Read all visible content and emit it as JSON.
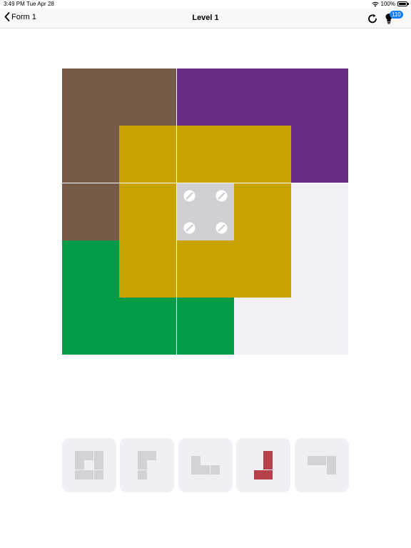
{
  "status_bar": {
    "time": "3:49 PM",
    "date": "Tue Apr 28",
    "battery": "100%"
  },
  "nav": {
    "back_label": "Form 1",
    "title": "Level 1",
    "hint_count": "110",
    "icons": [
      "chevron-left-icon",
      "restart-icon",
      "lightbulb-icon"
    ]
  },
  "colors": {
    "brown": "#735b48",
    "purple": "#6a2b87",
    "gold": "#c8a200",
    "green": "#009c48",
    "empty": "#f1f0f5",
    "blocked": "#d0cfd4",
    "tray_inactive": "#d3d2d7",
    "tray_active": "#b7414b",
    "badge": "#1a7cf5"
  },
  "board": {
    "rows": 5,
    "cols": 5,
    "grid": [
      [
        "brown",
        "brown",
        "purple",
        "purple",
        "purple"
      ],
      [
        "brown",
        "gold",
        "gold",
        "gold",
        "purple"
      ],
      [
        "brown",
        "gold",
        "blocked",
        "gold",
        "empty"
      ],
      [
        "green",
        "gold",
        "gold",
        "gold",
        "empty"
      ],
      [
        "green",
        "green",
        "green",
        "empty",
        "empty"
      ]
    ]
  },
  "tray": {
    "pieces": [
      {
        "name": "ring-piece",
        "placed": true,
        "shape": [
          [
            1,
            1,
            1
          ],
          [
            1,
            0,
            1
          ],
          [
            1,
            1,
            1
          ]
        ]
      },
      {
        "name": "corner-piece",
        "placed": true,
        "shape": [
          [
            1,
            1
          ],
          [
            1,
            0
          ],
          [
            1,
            0
          ]
        ]
      },
      {
        "name": "l-piece",
        "placed": true,
        "shape": [
          [
            1,
            0,
            0
          ],
          [
            1,
            1,
            1
          ]
        ]
      },
      {
        "name": "j-piece",
        "placed": false,
        "shape": [
          [
            0,
            1
          ],
          [
            0,
            1
          ],
          [
            1,
            1
          ]
        ]
      },
      {
        "name": "hook-piece",
        "placed": true,
        "shape": [
          [
            1,
            1,
            1
          ],
          [
            0,
            0,
            1
          ]
        ]
      }
    ]
  }
}
